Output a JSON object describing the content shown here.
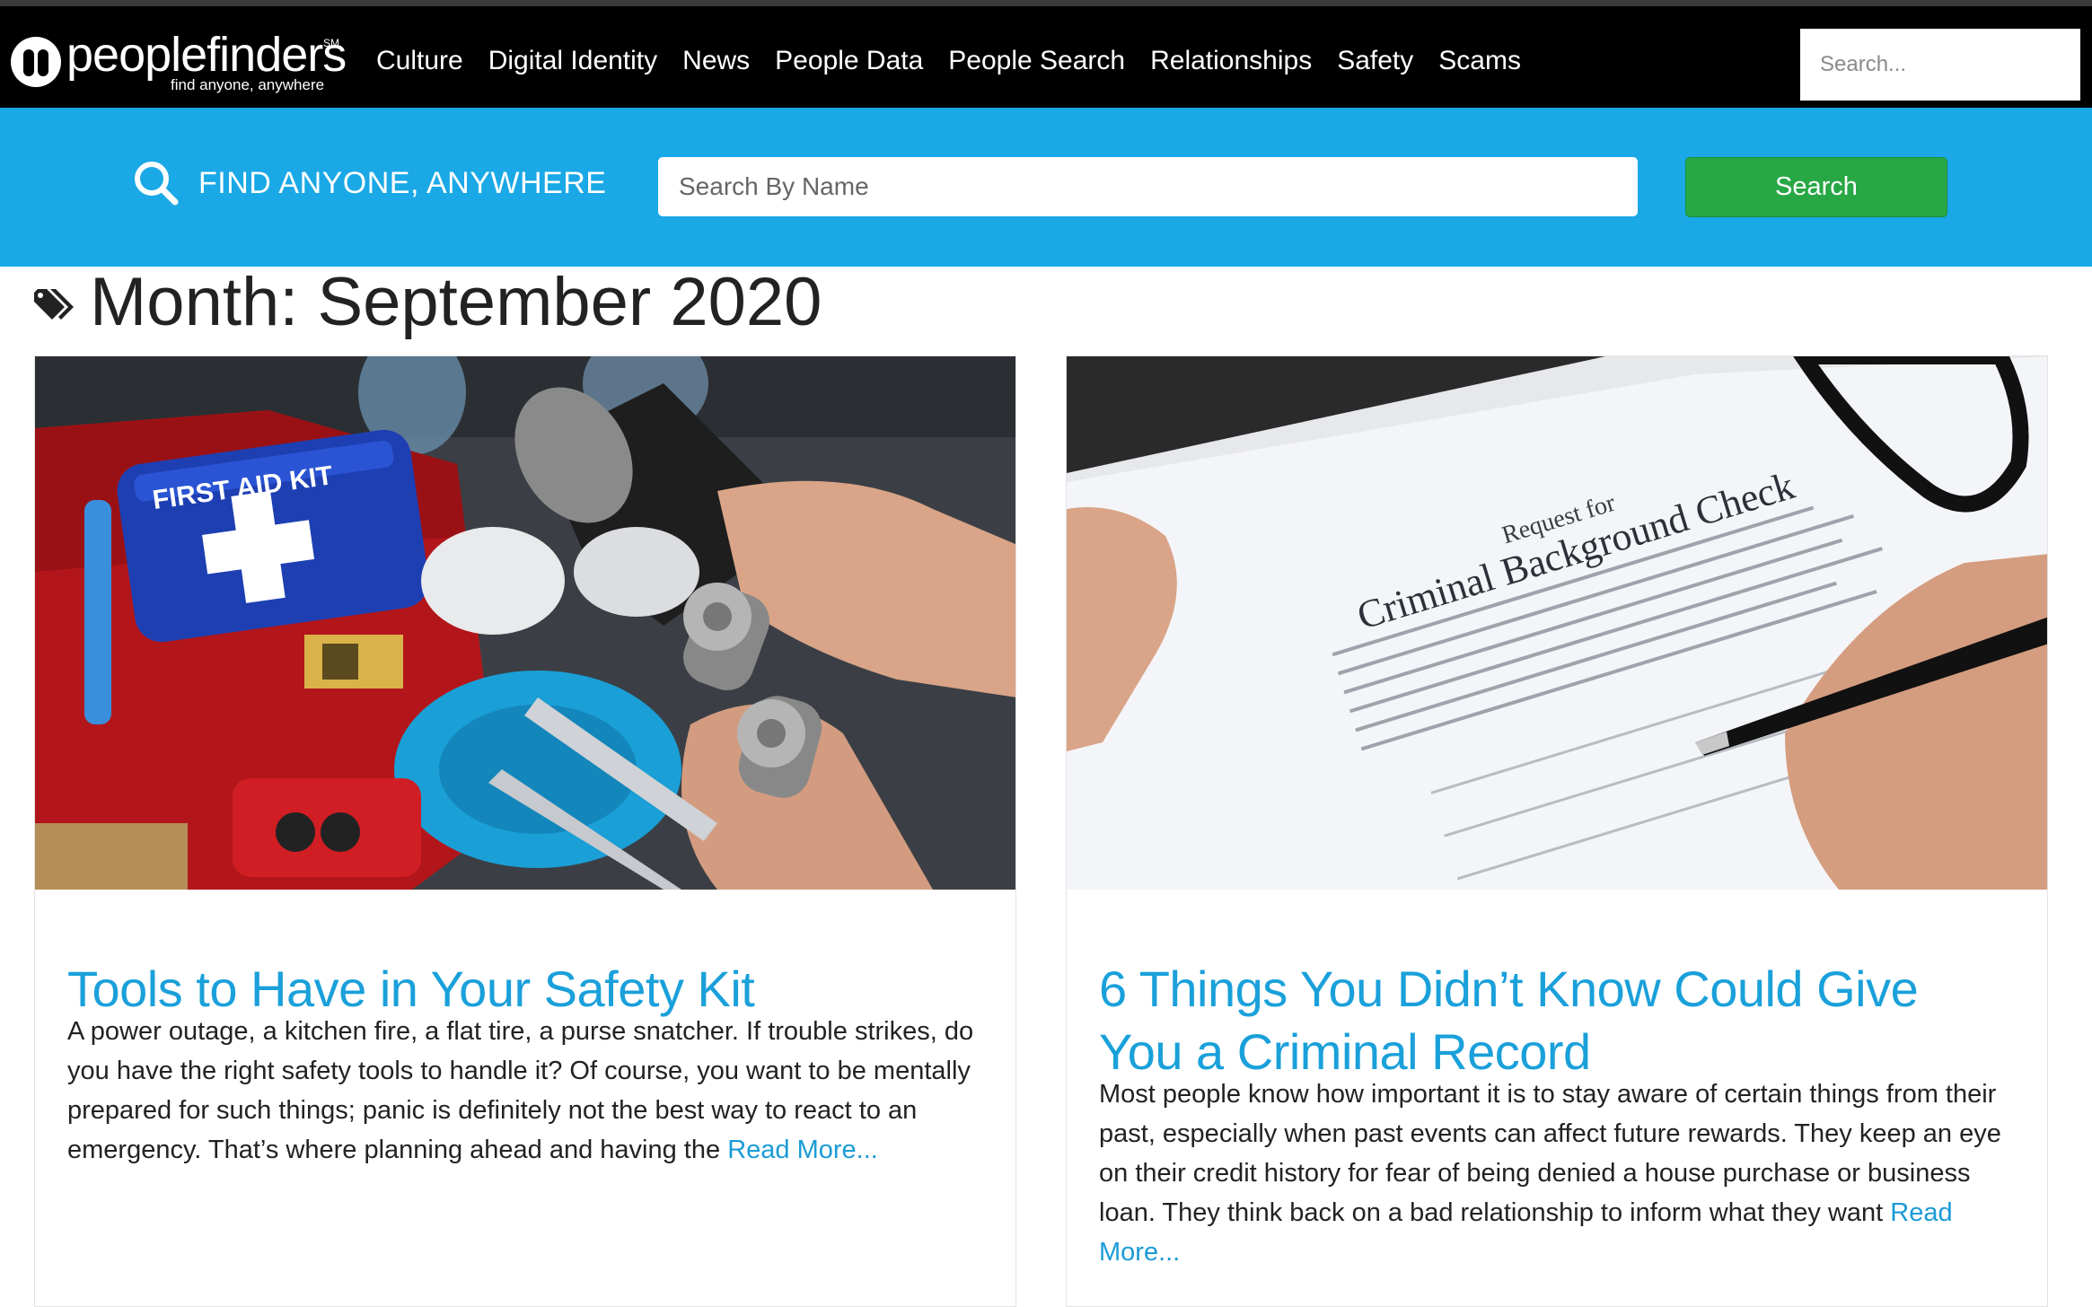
{
  "brand": {
    "name": "peoplefinders",
    "trademark": "SM",
    "tagline": "find anyone, anywhere"
  },
  "nav": {
    "items": [
      "Culture",
      "Digital Identity",
      "News",
      "People Data",
      "People Search",
      "Relationships",
      "Safety",
      "Scams"
    ]
  },
  "top_search": {
    "placeholder": "Search..."
  },
  "banner": {
    "title": "FIND ANYONE, ANYWHERE",
    "input_placeholder": "Search By Name",
    "button_label": "Search"
  },
  "archive": {
    "title": "Month: September 2020"
  },
  "posts": [
    {
      "title": "Tools to Have in Your Safety Kit",
      "excerpt": "A power outage, a kitchen fire, a flat tire, a purse snatcher. If trouble strikes, do you have the right safety tools to handle it? Of course, you want to be mentally prepared for such things; panic is definitely not the best way to react to an emergency. That’s where planning ahead and having the",
      "read_more": "Read More...",
      "image_text": "FIRST AID KIT"
    },
    {
      "title": "6 Things You Didn’t Know Could Give You a Criminal Record",
      "excerpt": "Most people know how important it is to stay aware of certain things from their past, especially when past events can affect future rewards. They keep an eye on their credit history for fear of being denied a house purchase or business loan. They think back on a bad relationship to inform what they want",
      "read_more": "Read More...",
      "image_text_small": "Request for",
      "image_text_large": "Criminal Background Check"
    }
  ],
  "colors": {
    "topbar": "#000000",
    "banner": "#1aa8e6",
    "button": "#28a745",
    "link": "#1aa0da"
  }
}
